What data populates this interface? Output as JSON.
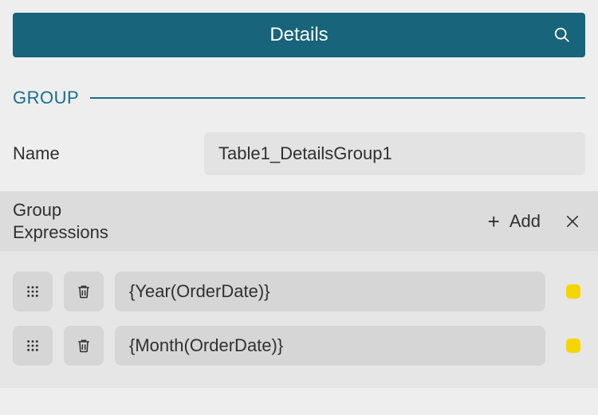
{
  "header": {
    "title": "Details"
  },
  "section": {
    "label": "GROUP"
  },
  "name_field": {
    "label": "Name",
    "value": "Table1_DetailsGroup1"
  },
  "expressions": {
    "label": "Group\nExpressions",
    "add_label": "Add",
    "rows": [
      {
        "value": "{Year(OrderDate)}"
      },
      {
        "value": "{Month(OrderDate)}"
      }
    ]
  }
}
